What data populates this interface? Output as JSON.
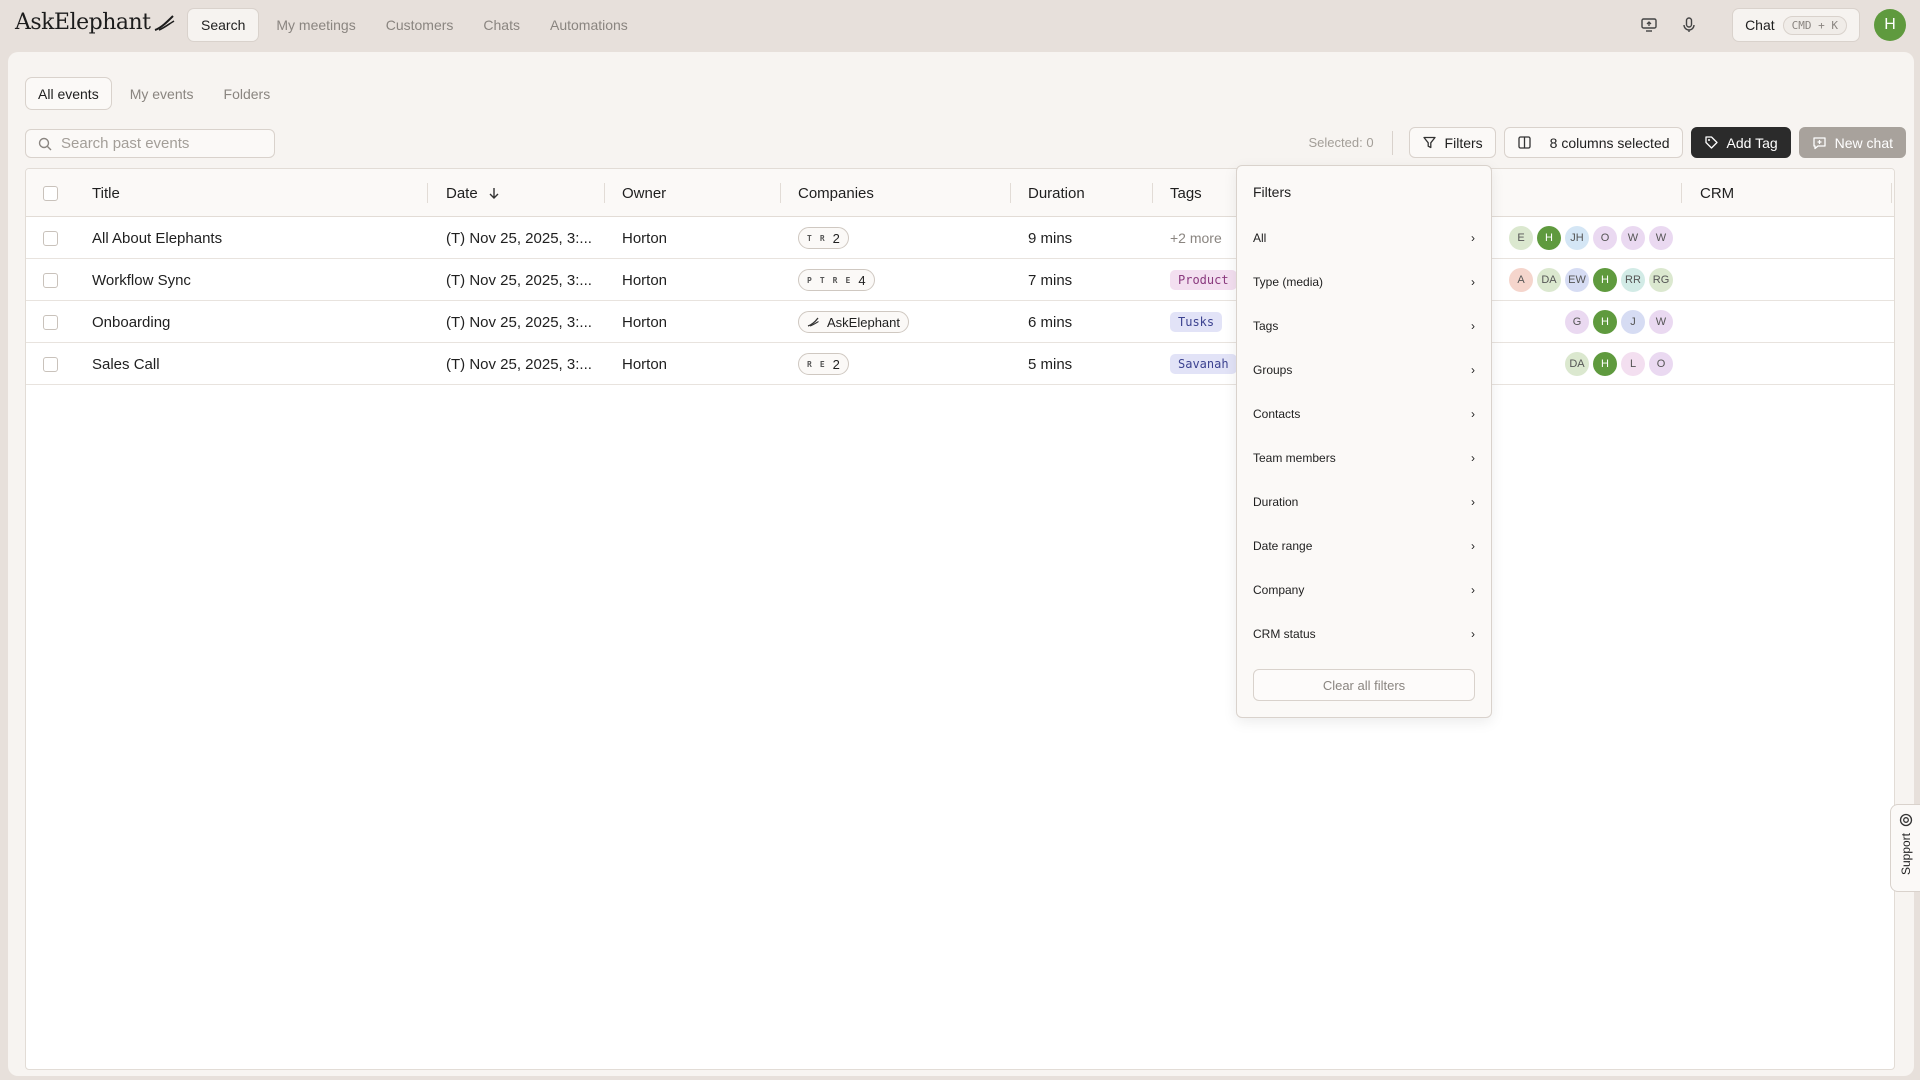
{
  "app": {
    "logo_text": "AskElephant"
  },
  "nav": {
    "items": [
      {
        "label": "Search",
        "active": true
      },
      {
        "label": "My meetings",
        "active": false
      },
      {
        "label": "Customers",
        "active": false
      },
      {
        "label": "Chats",
        "active": false
      },
      {
        "label": "Automations",
        "active": false
      }
    ],
    "chat_label": "Chat",
    "chat_shortcut": "CMD + K",
    "user_initial": "H"
  },
  "subtabs": [
    {
      "label": "All events",
      "active": true
    },
    {
      "label": "My events",
      "active": false
    },
    {
      "label": "Folders",
      "active": false
    }
  ],
  "search": {
    "placeholder": "Search past events",
    "value": ""
  },
  "toolbar": {
    "selected_count": "Selected: 0",
    "filters_label": "Filters",
    "columns_label": "8 columns selected",
    "add_tag_label": "Add Tag",
    "new_chat_label": "New chat"
  },
  "table": {
    "columns": [
      "Title",
      "Date",
      "Owner",
      "Companies",
      "Duration",
      "Tags",
      "CRM"
    ],
    "rows": [
      {
        "title": "All About Elephants",
        "date": "(T) Nov 25, 2025, 3:...",
        "owner": "Horton",
        "company_letters": [
          "T",
          "R"
        ],
        "company_count": "2",
        "duration": "9 mins",
        "tag": "+2 more",
        "people": [
          "E",
          "H",
          "JH",
          "O",
          "W",
          "W"
        ]
      },
      {
        "title": "Workflow Sync",
        "date": "(T) Nov 25, 2025, 3:...",
        "owner": "Horton",
        "company_letters": [
          "P",
          "T",
          "R",
          "E"
        ],
        "company_count": "4",
        "duration": "7 mins",
        "tag": "Product",
        "people": [
          "A",
          "DA",
          "EW",
          "H",
          "RR",
          "RG"
        ]
      },
      {
        "title": "Onboarding",
        "date": "(T) Nov 25, 2025, 3:...",
        "owner": "Horton",
        "company_name": "AskElephant",
        "duration": "6 mins",
        "tag": "Tusks",
        "people": [
          "G",
          "H",
          "J",
          "W"
        ]
      },
      {
        "title": "Sales Call",
        "date": "(T) Nov 25, 2025, 3:...",
        "owner": "Horton",
        "company_letters": [
          "R",
          "E"
        ],
        "company_count": "2",
        "duration": "5 mins",
        "tag": "Savanah",
        "people": [
          "DA",
          "H",
          "L",
          "O"
        ]
      }
    ]
  },
  "filters_panel": {
    "title": "Filters",
    "items": [
      "All",
      "Type (media)",
      "Tags",
      "Groups",
      "Contacts",
      "Team members",
      "Duration",
      "Date range",
      "Company",
      "CRM status"
    ],
    "clear_label": "Clear all filters"
  },
  "support": {
    "label": "Support"
  },
  "colors": {
    "accent_green": "#5f9a3e",
    "tag_product_bg": "#f3dff0",
    "tag_tusks_bg": "#e2e3f7",
    "tag_savanah_bg": "#e2e3f7"
  }
}
